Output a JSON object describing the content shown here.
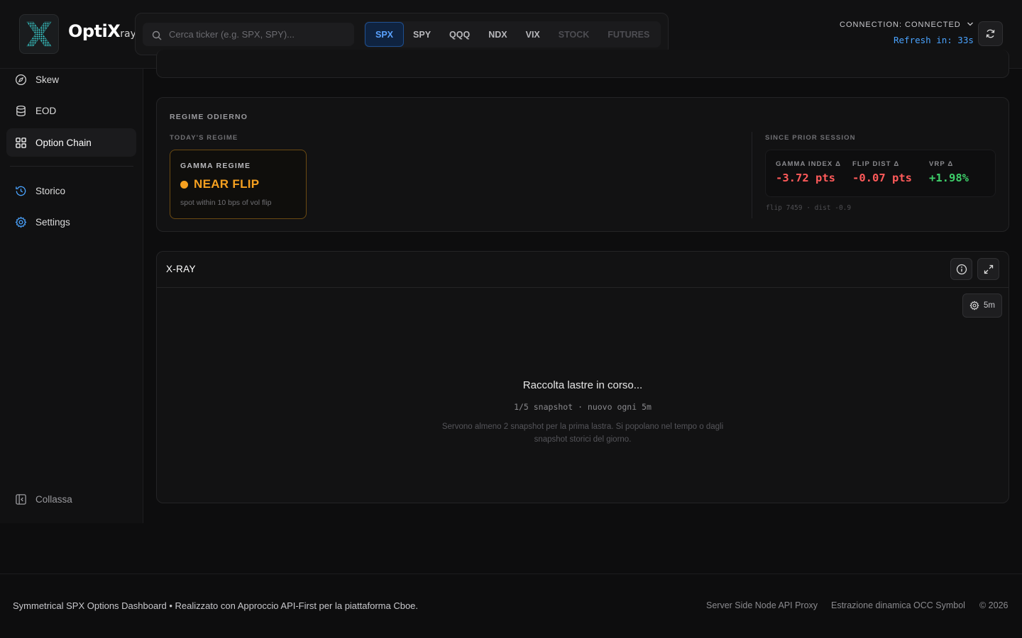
{
  "brand": {
    "name": "OptiX",
    "sub": "ray"
  },
  "search": {
    "placeholder": "Cerca ticker (e.g. SPX, SPY)..."
  },
  "tickers": [
    {
      "label": "SPX",
      "state": "active"
    },
    {
      "label": "SPY",
      "state": "normal"
    },
    {
      "label": "QQQ",
      "state": "normal"
    },
    {
      "label": "NDX",
      "state": "normal"
    },
    {
      "label": "VIX",
      "state": "normal"
    },
    {
      "label": "STOCK",
      "state": "disabled"
    },
    {
      "label": "FUTURES",
      "state": "disabled"
    }
  ],
  "connection": {
    "status": "CONNECTION: CONNECTED",
    "refresh": "Refresh in: 33s"
  },
  "sidebar": {
    "items": [
      {
        "label": "Skew",
        "icon": "compass-icon"
      },
      {
        "label": "EOD",
        "icon": "database-icon"
      },
      {
        "label": "Option Chain",
        "icon": "grid-icon",
        "active": true
      },
      {
        "label": "Storico",
        "icon": "history-icon"
      },
      {
        "label": "Settings",
        "icon": "gear-icon"
      }
    ],
    "collapse": "Collassa"
  },
  "regime": {
    "title": "REGIME ODIERNO",
    "today_label": "TODAY'S REGIME",
    "gamma_label": "GAMMA REGIME",
    "status": "NEAR FLIP",
    "status_color": "#f5a020",
    "description": "spot within 10 bps of vol flip",
    "since_label": "SINCE PRIOR SESSION",
    "deltas": [
      {
        "label": "GAMMA INDEX Δ",
        "value": "-3.72 pts",
        "sign": "neg"
      },
      {
        "label": "FLIP DIST Δ",
        "value": "-0.07 pts",
        "sign": "neg"
      },
      {
        "label": "VRP Δ",
        "value": "+1.98%",
        "sign": "pos"
      }
    ],
    "note": "flip 7459 · dist -0.9"
  },
  "xray": {
    "title": "X-RAY",
    "interval": "5m",
    "loading_title": "Raccolta lastre in corso...",
    "loading_sub": "1/5 snapshot · nuovo ogni 5m",
    "loading_desc": "Servono almeno 2 snapshot per la prima lastra. Si popolano nel tempo o dagli snapshot storici del giorno."
  },
  "footer": {
    "left": "Symmetrical SPX Options Dashboard • Realizzato con Approccio API-First per la piattaforma Cboe.",
    "links": [
      "Server Side Node API Proxy",
      "Estrazione dinamica OCC Symbol",
      "© 2026"
    ]
  },
  "colors": {
    "accent": "#4aa3ff",
    "warning": "#f5a020",
    "negative": "#ff5a5a",
    "positive": "#3ecf6a"
  }
}
